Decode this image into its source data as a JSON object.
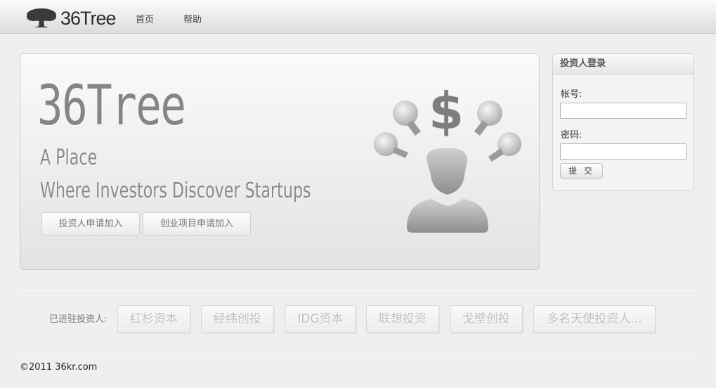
{
  "header": {
    "logo_text": "36Tree",
    "nav": [
      {
        "label": "首页"
      },
      {
        "label": "帮助"
      }
    ]
  },
  "hero": {
    "title": "36Tree",
    "line1": "A Place",
    "line2": "Where Investors Discover Startups",
    "buttons": [
      {
        "label": "投资人申请加入"
      },
      {
        "label": "创业项目申请加入"
      }
    ]
  },
  "login": {
    "title": "投资人登录",
    "account_label": "帐号:",
    "account_value": "",
    "password_label": "密码:",
    "password_value": "",
    "submit_label": "提 交"
  },
  "investors": {
    "label": "已进驻投资人:",
    "items": [
      {
        "label": "红杉资本"
      },
      {
        "label": "经纬创投"
      },
      {
        "label": "IDG资本"
      },
      {
        "label": "联想投资"
      },
      {
        "label": "戈壁创投"
      },
      {
        "label": "多名天使投资人..."
      }
    ]
  },
  "footer": {
    "copyright": "©2011 36kr.com"
  },
  "colors": {
    "background": "#efefef",
    "hero_text": "#858585",
    "tag_text": "#bdbdbd"
  },
  "icons": [
    "tree-logo-icon",
    "investor-bulb-dollar-icon"
  ]
}
